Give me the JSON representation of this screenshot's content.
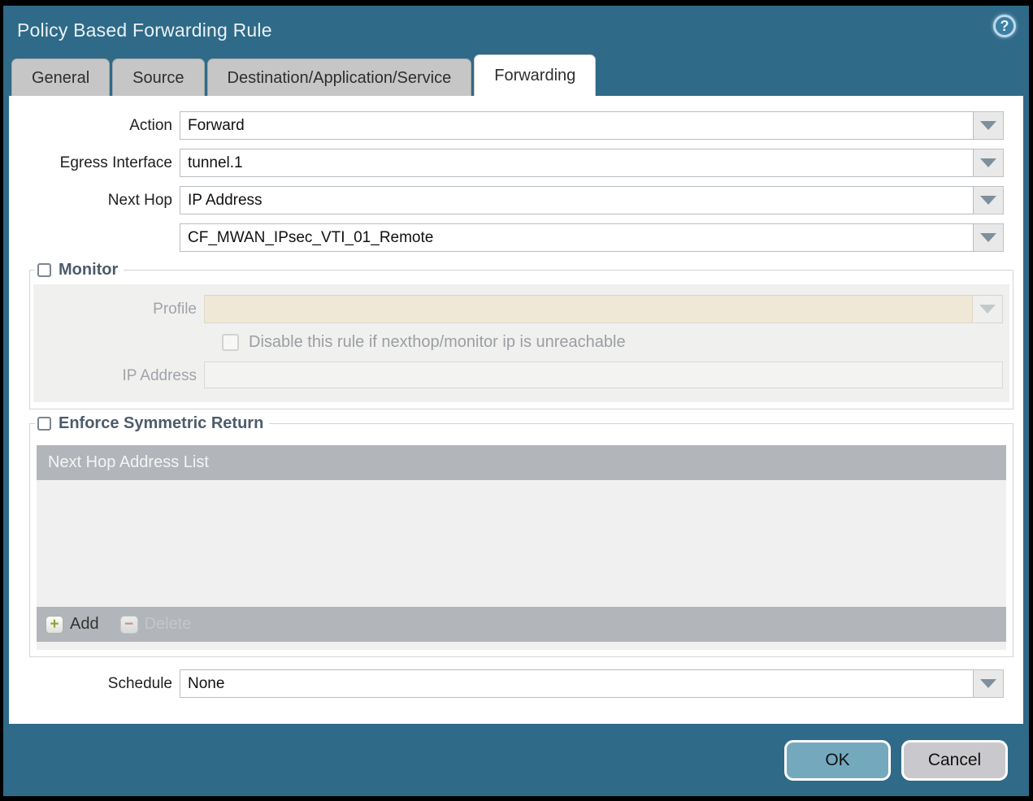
{
  "dialog": {
    "title": "Policy Based Forwarding Rule"
  },
  "icons": {
    "help": "?",
    "add": "+",
    "delete": "−"
  },
  "tabs": [
    {
      "label": "General",
      "active": false
    },
    {
      "label": "Source",
      "active": false
    },
    {
      "label": "Destination/Application/Service",
      "active": false
    },
    {
      "label": "Forwarding",
      "active": true
    }
  ],
  "form": {
    "action": {
      "label": "Action",
      "value": "Forward"
    },
    "egress_interface": {
      "label": "Egress Interface",
      "value": "tunnel.1"
    },
    "next_hop": {
      "label": "Next Hop",
      "value": "IP Address"
    },
    "next_hop_address": {
      "value": "CF_MWAN_IPsec_VTI_01_Remote"
    },
    "schedule": {
      "label": "Schedule",
      "value": "None"
    }
  },
  "monitor": {
    "title": "Monitor",
    "checked": false,
    "profile": {
      "label": "Profile",
      "value": ""
    },
    "disable_rule": {
      "label": "Disable this rule if nexthop/monitor ip is unreachable",
      "checked": false
    },
    "ip_address": {
      "label": "IP Address",
      "value": ""
    }
  },
  "symmetric_return": {
    "title": "Enforce Symmetric Return",
    "checked": false,
    "table_header": "Next Hop Address List",
    "rows": [],
    "add_label": "Add",
    "delete_label": "Delete",
    "delete_enabled": false
  },
  "footer": {
    "ok_label": "OK",
    "cancel_label": "Cancel"
  },
  "colors": {
    "chrome_teal": "#2f6a88",
    "active_tab": "#ffffff",
    "inactive_tab": "#c6c6c6",
    "profile_field_beige": "#efe8d7",
    "table_bar_gray": "#b2b6ba",
    "ok_button": "#74a9bd",
    "cancel_button": "#c9c9cd",
    "add_plus_green": "#8ca43c"
  }
}
